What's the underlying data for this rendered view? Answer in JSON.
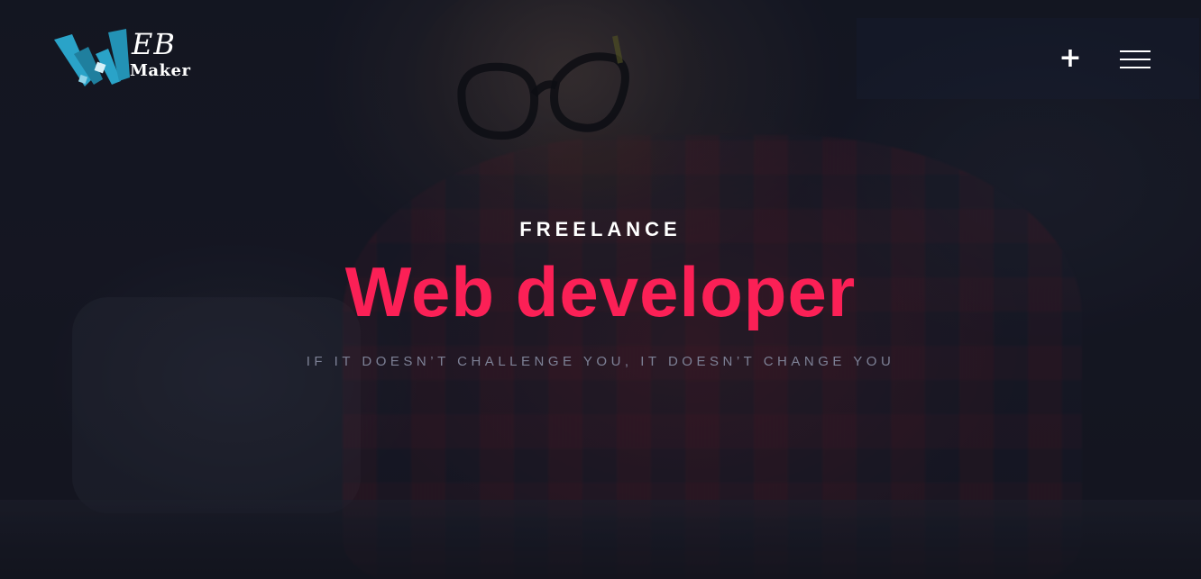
{
  "header": {
    "logo": {
      "line1": "EB",
      "line2": "Maker"
    },
    "plus_button_glyph": "+",
    "menu_icon": "hamburger-menu-icon"
  },
  "hero": {
    "kicker": "FREELANCE",
    "headline": "Web developer",
    "tagline": "IF IT DOESN’T CHALLENGE YOU, IT DOESN’T CHANGE YOU"
  },
  "colors": {
    "accent": "#fb2056",
    "logo_blue": "#2aa3c8",
    "background": "#171a26",
    "tagline": "#7d8196"
  }
}
